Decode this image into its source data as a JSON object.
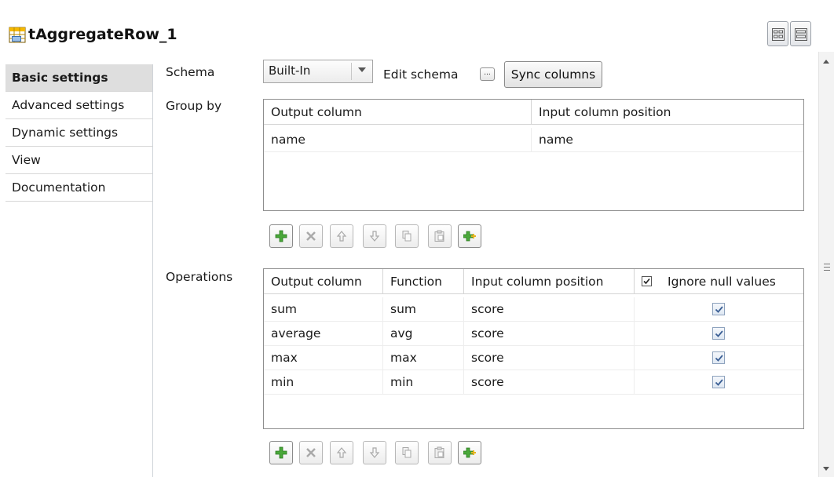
{
  "component": {
    "title": "tAggregateRow_1",
    "icon": "table-component-icon"
  },
  "sidebar": {
    "items": [
      {
        "label": "Basic settings",
        "active": true
      },
      {
        "label": "Advanced settings"
      },
      {
        "label": "Dynamic settings"
      },
      {
        "label": "View"
      },
      {
        "label": "Documentation"
      }
    ]
  },
  "schema": {
    "label": "Schema",
    "value": "Built-In",
    "edit_label": "Edit schema",
    "edit_button": "...",
    "sync_label": "Sync columns"
  },
  "group_by": {
    "label": "Group by",
    "headers": [
      "Output column",
      "Input column position"
    ],
    "rows": [
      [
        "name",
        "name"
      ]
    ]
  },
  "operations": {
    "label": "Operations",
    "headers": [
      "Output column",
      "Function",
      "Input column position",
      "Ignore null values"
    ],
    "header_checked": true,
    "rows": [
      {
        "output": "sum",
        "function": "sum",
        "input": "score",
        "ignore_null": true
      },
      {
        "output": "average",
        "function": "avg",
        "input": "score",
        "ignore_null": true
      },
      {
        "output": "max",
        "function": "max",
        "input": "score",
        "ignore_null": true
      },
      {
        "output": "min",
        "function": "min",
        "input": "score",
        "ignore_null": true
      }
    ]
  },
  "toolbar_icons": [
    "add-icon",
    "remove-icon",
    "move-up-icon",
    "move-down-icon",
    "copy-icon",
    "paste-icon",
    "add-all-icon"
  ],
  "colors": {
    "accent_green": "#3c9a2e",
    "sidebar_active": "#dedede",
    "checkbox_blue": "#3b5f95"
  }
}
